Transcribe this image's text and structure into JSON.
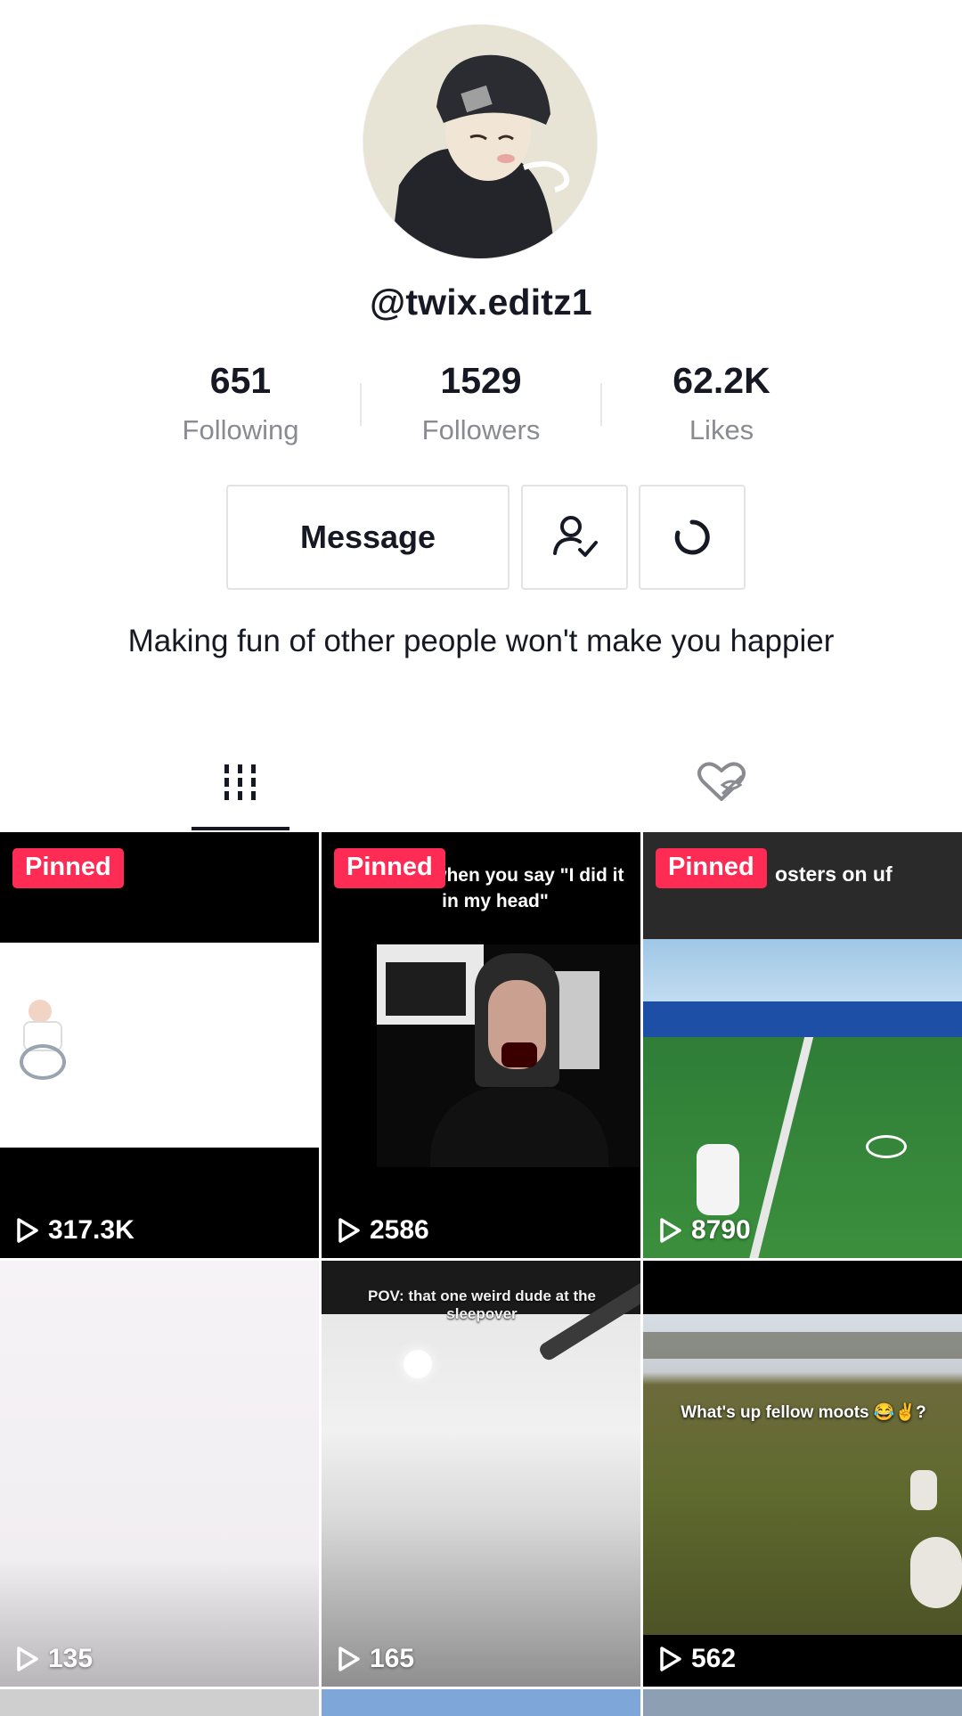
{
  "profile": {
    "username": "@twix.editz1",
    "bio": "Making fun of other people won't make you happier"
  },
  "stats": [
    {
      "value": "651",
      "label": "Following"
    },
    {
      "value": "1529",
      "label": "Followers"
    },
    {
      "value": "62.2K",
      "label": "Likes"
    }
  ],
  "actions": {
    "message_label": "Message",
    "following_icon": "person-check-icon",
    "suggest_icon": "refresh-icon"
  },
  "tabs": [
    {
      "icon": "grid-icon",
      "active": true
    },
    {
      "icon": "liked-heart-hidden-icon",
      "active": false
    }
  ],
  "videos": [
    {
      "pinned": "Pinned",
      "views": "317.3K",
      "caption": ""
    },
    {
      "pinned": "Pinned",
      "views": "2586",
      "caption": "eacher when you say \"I did it in my head\""
    },
    {
      "pinned": "Pinned",
      "views": "8790",
      "caption": "osters on uf"
    },
    {
      "pinned": "",
      "views": "135",
      "caption": ""
    },
    {
      "pinned": "",
      "views": "165",
      "caption": "POV: that one weird dude at the sleepover"
    },
    {
      "pinned": "",
      "views": "562",
      "caption": "What's up fellow moots 😂✌️?"
    }
  ],
  "colors": {
    "accent": "#fe2c55",
    "text": "#161823",
    "muted": "#8a8b91"
  }
}
